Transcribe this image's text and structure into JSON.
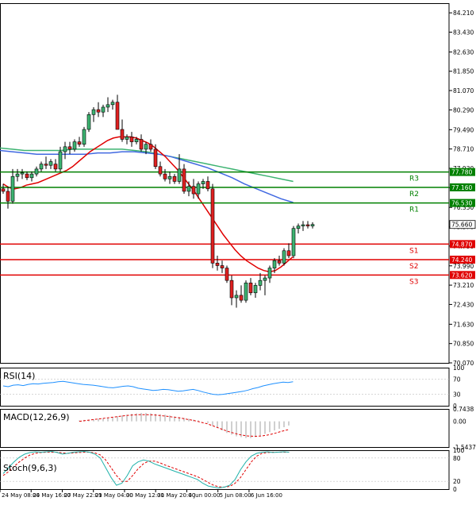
{
  "chart_data": [
    {
      "type": "candlestick",
      "name": "price",
      "ylim": [
        70.07,
        84.6
      ],
      "y_ticks": [
        "84.210",
        "83.430",
        "82.630",
        "81.850",
        "81.070",
        "80.290",
        "79.490",
        "78.710",
        "77.930",
        "77.150",
        "76.350",
        "75.570",
        "74.790",
        "73.990",
        "73.210",
        "72.430",
        "71.630",
        "70.850",
        "70.070"
      ],
      "time_labels": [
        "24 May 08:00",
        "24 May 16:00",
        "27 May 22:01",
        "29 May 04:00",
        "30 May 12:00",
        "31 May 20:00",
        "4 Jun 00:00",
        "5 Jun 08:00",
        "6 Jun 16:00"
      ],
      "time_label_index": [
        0,
        12,
        24,
        36,
        48,
        60,
        72,
        84,
        96
      ],
      "candles": [
        {
          "o": 77.1,
          "h": 77.3,
          "l": 76.9,
          "c": 77.0
        },
        {
          "o": 77.0,
          "h": 77.2,
          "l": 76.3,
          "c": 76.6
        },
        {
          "o": 76.6,
          "h": 77.9,
          "l": 76.5,
          "c": 77.6
        },
        {
          "o": 77.6,
          "h": 77.9,
          "l": 77.4,
          "c": 77.7
        },
        {
          "o": 77.7,
          "h": 77.9,
          "l": 77.5,
          "c": 77.75
        },
        {
          "o": 77.7,
          "h": 77.8,
          "l": 77.45,
          "c": 77.55
        },
        {
          "o": 77.55,
          "h": 77.8,
          "l": 77.4,
          "c": 77.7
        },
        {
          "o": 77.7,
          "h": 78.0,
          "l": 77.6,
          "c": 77.9
        },
        {
          "o": 77.9,
          "h": 78.2,
          "l": 77.8,
          "c": 78.1
        },
        {
          "o": 78.1,
          "h": 78.4,
          "l": 77.9,
          "c": 78.05
        },
        {
          "o": 78.05,
          "h": 78.3,
          "l": 77.9,
          "c": 78.2
        },
        {
          "o": 78.1,
          "h": 78.3,
          "l": 77.8,
          "c": 77.9
        },
        {
          "o": 77.9,
          "h": 78.8,
          "l": 77.8,
          "c": 78.6
        },
        {
          "o": 78.6,
          "h": 79.0,
          "l": 78.3,
          "c": 78.8
        },
        {
          "o": 78.8,
          "h": 79.0,
          "l": 78.5,
          "c": 78.7
        },
        {
          "o": 78.7,
          "h": 79.1,
          "l": 78.6,
          "c": 79.0
        },
        {
          "o": 79.0,
          "h": 79.2,
          "l": 78.8,
          "c": 78.9
        },
        {
          "o": 78.9,
          "h": 79.6,
          "l": 78.8,
          "c": 79.5
        },
        {
          "o": 79.5,
          "h": 80.2,
          "l": 79.4,
          "c": 80.1
        },
        {
          "o": 80.1,
          "h": 80.4,
          "l": 79.8,
          "c": 80.3
        },
        {
          "o": 80.3,
          "h": 80.6,
          "l": 80.0,
          "c": 80.2
        },
        {
          "o": 80.2,
          "h": 80.5,
          "l": 80.0,
          "c": 80.4
        },
        {
          "o": 80.4,
          "h": 80.8,
          "l": 80.2,
          "c": 80.5
        },
        {
          "o": 80.5,
          "h": 80.7,
          "l": 80.3,
          "c": 80.6
        },
        {
          "o": 80.6,
          "h": 80.9,
          "l": 79.8,
          "c": 79.5
        },
        {
          "o": 79.5,
          "h": 79.9,
          "l": 79.0,
          "c": 79.1
        },
        {
          "o": 79.1,
          "h": 79.3,
          "l": 78.9,
          "c": 79.2
        },
        {
          "o": 79.2,
          "h": 79.4,
          "l": 78.8,
          "c": 79.0
        },
        {
          "o": 79.0,
          "h": 79.2,
          "l": 78.9,
          "c": 79.1
        },
        {
          "o": 79.1,
          "h": 79.3,
          "l": 78.6,
          "c": 78.7
        },
        {
          "o": 78.7,
          "h": 79.0,
          "l": 78.5,
          "c": 78.9
        },
        {
          "o": 78.9,
          "h": 79.1,
          "l": 78.6,
          "c": 78.7
        },
        {
          "o": 78.7,
          "h": 78.9,
          "l": 77.9,
          "c": 78.0
        },
        {
          "o": 78.0,
          "h": 78.2,
          "l": 77.6,
          "c": 77.7
        },
        {
          "o": 77.7,
          "h": 77.9,
          "l": 77.4,
          "c": 77.5
        },
        {
          "o": 77.5,
          "h": 77.8,
          "l": 77.3,
          "c": 77.6
        },
        {
          "o": 77.6,
          "h": 77.7,
          "l": 77.3,
          "c": 77.4
        },
        {
          "o": 77.4,
          "h": 78.5,
          "l": 77.3,
          "c": 77.9
        },
        {
          "o": 77.9,
          "h": 78.1,
          "l": 76.9,
          "c": 77.0
        },
        {
          "o": 77.0,
          "h": 77.4,
          "l": 76.8,
          "c": 77.2
        },
        {
          "o": 77.2,
          "h": 77.5,
          "l": 76.7,
          "c": 76.9
        },
        {
          "o": 76.9,
          "h": 77.4,
          "l": 76.7,
          "c": 77.3
        },
        {
          "o": 77.3,
          "h": 77.5,
          "l": 77.1,
          "c": 77.4
        },
        {
          "o": 77.4,
          "h": 77.6,
          "l": 77.0,
          "c": 77.1
        },
        {
          "o": 77.1,
          "h": 77.3,
          "l": 73.9,
          "c": 74.1
        },
        {
          "o": 74.1,
          "h": 74.4,
          "l": 73.8,
          "c": 74.0
        },
        {
          "o": 74.0,
          "h": 74.2,
          "l": 73.7,
          "c": 73.9
        },
        {
          "o": 73.9,
          "h": 74.0,
          "l": 73.3,
          "c": 73.4
        },
        {
          "o": 73.4,
          "h": 73.6,
          "l": 72.4,
          "c": 72.7
        },
        {
          "o": 72.7,
          "h": 73.0,
          "l": 72.3,
          "c": 72.8
        },
        {
          "o": 72.8,
          "h": 73.2,
          "l": 72.5,
          "c": 72.6
        },
        {
          "o": 72.6,
          "h": 73.4,
          "l": 72.5,
          "c": 73.3
        },
        {
          "o": 73.3,
          "h": 73.5,
          "l": 72.8,
          "c": 72.9
        },
        {
          "o": 72.9,
          "h": 73.3,
          "l": 72.7,
          "c": 73.2
        },
        {
          "o": 73.2,
          "h": 73.7,
          "l": 73.0,
          "c": 73.4
        },
        {
          "o": 73.4,
          "h": 73.6,
          "l": 72.8,
          "c": 73.5
        },
        {
          "o": 73.5,
          "h": 74.0,
          "l": 73.3,
          "c": 73.9
        },
        {
          "o": 73.9,
          "h": 74.3,
          "l": 73.7,
          "c": 74.2
        },
        {
          "o": 74.2,
          "h": 74.4,
          "l": 74.0,
          "c": 74.1
        },
        {
          "o": 74.1,
          "h": 74.7,
          "l": 74.0,
          "c": 74.6
        },
        {
          "o": 74.6,
          "h": 74.9,
          "l": 74.3,
          "c": 74.4
        },
        {
          "o": 74.4,
          "h": 75.6,
          "l": 74.3,
          "c": 75.5
        },
        {
          "o": 75.5,
          "h": 75.7,
          "l": 75.3,
          "c": 75.6
        },
        {
          "o": 75.6,
          "h": 75.8,
          "l": 75.4,
          "c": 75.65
        },
        {
          "o": 75.65,
          "h": 75.8,
          "l": 75.5,
          "c": 75.6
        },
        {
          "o": 75.6,
          "h": 75.75,
          "l": 75.5,
          "c": 75.66
        }
      ],
      "ma_red": [
        77.3,
        77.15,
        77.1,
        77.15,
        77.25,
        77.3,
        77.35,
        77.45,
        77.55,
        77.65,
        77.75,
        77.85,
        78.0,
        78.2,
        78.4,
        78.6,
        78.75,
        78.9,
        79.05,
        79.15,
        79.2,
        79.2,
        79.2,
        79.15,
        79.05,
        78.95,
        78.8,
        78.6,
        78.4,
        78.15,
        77.9,
        77.6,
        77.3,
        77.0,
        76.65,
        76.3,
        75.95,
        75.6,
        75.25,
        74.95,
        74.65,
        74.4,
        74.2,
        74.05,
        73.9,
        73.8,
        73.75,
        73.8,
        73.95,
        74.15,
        74.35
      ],
      "ma_blue": [
        78.65,
        78.6,
        78.55,
        78.5,
        78.5,
        78.5,
        78.5,
        78.5,
        78.55,
        78.55,
        78.6,
        78.6,
        78.55,
        78.5,
        78.4,
        78.25,
        78.1,
        77.95,
        77.75,
        77.55,
        77.3,
        77.1,
        76.9,
        76.7,
        76.55
      ],
      "ma_green": [
        78.75,
        78.7,
        78.65,
        78.65,
        78.65,
        78.65,
        78.7,
        78.7,
        78.7,
        78.7,
        78.7,
        78.65,
        78.6,
        78.5,
        78.4,
        78.3,
        78.2,
        78.1,
        78.0,
        77.9,
        77.8,
        77.7,
        77.6,
        77.5,
        77.4
      ],
      "levels": [
        {
          "name": "R3",
          "value": 77.78,
          "label": "77.780",
          "color": "#008000"
        },
        {
          "name": "R2",
          "value": 77.16,
          "label": "77.160",
          "color": "#008000"
        },
        {
          "name": "R1",
          "value": 76.53,
          "label": "76.530",
          "color": "#008000"
        },
        {
          "name": "S1",
          "value": 74.87,
          "label": "74.870",
          "color": "#e00000"
        },
        {
          "name": "S2",
          "value": 74.24,
          "label": "74.240",
          "color": "#e00000"
        },
        {
          "name": "S3",
          "value": 73.62,
          "label": "73.620",
          "color": "#e00000"
        }
      ],
      "current_price": {
        "value": 75.66,
        "label": "75.660"
      }
    },
    {
      "type": "line",
      "name": "RSI(14)",
      "title": "RSI(14)",
      "ylim": [
        0,
        100
      ],
      "y_ticks": [
        "100",
        "70",
        "30",
        "0"
      ],
      "values": [
        52,
        50,
        54,
        55,
        53,
        56,
        58,
        57,
        59,
        60,
        61,
        63,
        64,
        62,
        60,
        58,
        56,
        55,
        54,
        52,
        50,
        48,
        47,
        49,
        51,
        52,
        50,
        46,
        44,
        42,
        40,
        41,
        43,
        42,
        40,
        38,
        39,
        41,
        43,
        40,
        36,
        33,
        30,
        29,
        30,
        32,
        34,
        36,
        38,
        41,
        45,
        48,
        52,
        55,
        58,
        60,
        62,
        61,
        63
      ]
    },
    {
      "type": "bar",
      "name": "MACD(12,26,9)",
      "title": "MACD(12,26,9)",
      "ylim": [
        -1.5437,
        0.7438
      ],
      "y_ticks": [
        "0.7438",
        "0.00",
        "-1.5437"
      ],
      "histogram": [
        0.05,
        0.08,
        0.1,
        0.12,
        0.15,
        0.18,
        0.2,
        0.25,
        0.3,
        0.35,
        0.4,
        0.45,
        0.48,
        0.5,
        0.5,
        0.48,
        0.45,
        0.42,
        0.4,
        0.35,
        0.3,
        0.25,
        0.2,
        0.15,
        0.1,
        0.05,
        0.0,
        -0.1,
        -0.25,
        -0.4,
        -0.55,
        -0.7,
        -0.8,
        -0.9,
        -0.95,
        -1.0,
        -1.0,
        -0.95,
        -0.85,
        -0.75,
        -0.65,
        -0.55,
        -0.45,
        -0.35,
        -0.25
      ],
      "signal": [
        0.0,
        0.05,
        0.1,
        0.15,
        0.2,
        0.25,
        0.3,
        0.35,
        0.38,
        0.4,
        0.4,
        0.38,
        0.35,
        0.3,
        0.25,
        0.2,
        0.12,
        0.05,
        -0.05,
        -0.15,
        -0.3,
        -0.45,
        -0.6,
        -0.72,
        -0.82,
        -0.88,
        -0.9,
        -0.88,
        -0.82,
        -0.72,
        -0.6,
        -0.5
      ]
    },
    {
      "type": "line",
      "name": "Stoch(9,6,3)",
      "title": "Stoch(9,6,3)",
      "ylim": [
        0,
        100
      ],
      "y_ticks": [
        "100",
        "80",
        "20",
        "0"
      ],
      "main": [
        40,
        55,
        70,
        82,
        90,
        94,
        96,
        95,
        96,
        97,
        94,
        90,
        92,
        95,
        96,
        97,
        95,
        90,
        80,
        55,
        30,
        10,
        15,
        35,
        60,
        70,
        75,
        72,
        65,
        60,
        55,
        50,
        45,
        40,
        35,
        30,
        25,
        15,
        8,
        5,
        3,
        5,
        10,
        25,
        50,
        70,
        85,
        92,
        95,
        96,
        94,
        95,
        96,
        95
      ],
      "signal": [
        35,
        45,
        58,
        70,
        80,
        88,
        92,
        94,
        95,
        95,
        95,
        93,
        92,
        93,
        94,
        95,
        95,
        93,
        88,
        75,
        55,
        35,
        20,
        20,
        35,
        52,
        65,
        72,
        72,
        68,
        62,
        57,
        52,
        47,
        42,
        37,
        32,
        25,
        17,
        10,
        6,
        5,
        7,
        15,
        30,
        50,
        70,
        85,
        92,
        94,
        95,
        95,
        95,
        95
      ]
    }
  ]
}
